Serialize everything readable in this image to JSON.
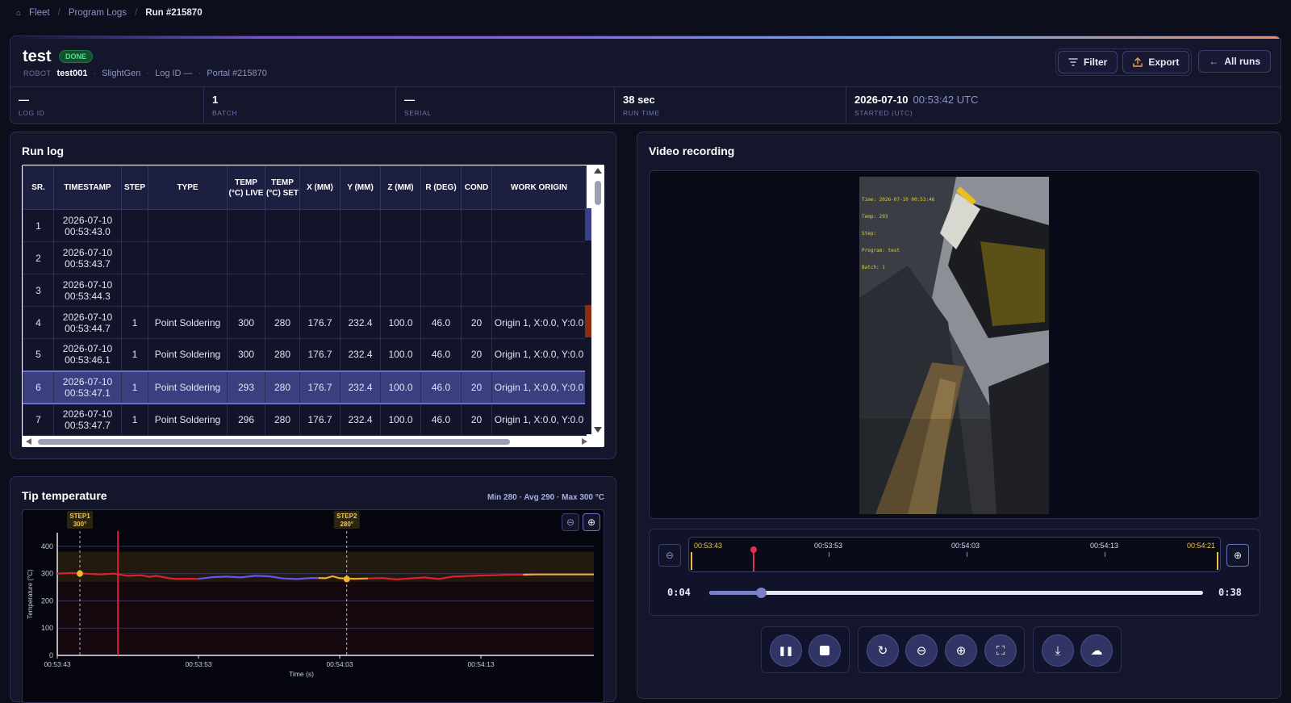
{
  "breadcrumb": {
    "home": "Fleet",
    "mid": "Program Logs",
    "current": "Run #215870"
  },
  "header": {
    "title": "test",
    "status": "DONE",
    "robot_label": "ROBOT",
    "robot": "test001",
    "model": "SlightGen",
    "log_id": "Log ID —",
    "portal": "Portal #215870",
    "buttons": {
      "filter": "Filter",
      "export": "Export",
      "all_runs": "All runs"
    }
  },
  "stats": [
    {
      "value": "—",
      "label": "LOG ID"
    },
    {
      "value": "1",
      "label": "BATCH"
    },
    {
      "value": "—",
      "label": "SERIAL"
    },
    {
      "value": "38 sec",
      "label": "RUN TIME"
    },
    {
      "value": "2026-07-10",
      "sub": "00:53:42 UTC",
      "label": "STARTED (UTC)"
    }
  ],
  "runlog": {
    "title": "Run log",
    "columns": [
      "SR.",
      "TIMESTAMP",
      "STEP",
      "TYPE",
      "TEMP (°C) LIVE",
      "TEMP (°C) SET",
      "X (MM)",
      "Y (MM)",
      "Z (MM)",
      "R (DEG)",
      "COND",
      "WORK ORIGIN"
    ],
    "rows": [
      [
        "1",
        "2026-07-10 00:53:43.0",
        "",
        "",
        "",
        "",
        "",
        "",
        "",
        "",
        "",
        ""
      ],
      [
        "2",
        "2026-07-10 00:53:43.7",
        "",
        "",
        "",
        "",
        "",
        "",
        "",
        "",
        "",
        ""
      ],
      [
        "3",
        "2026-07-10 00:53:44.3",
        "",
        "",
        "",
        "",
        "",
        "",
        "",
        "",
        "",
        ""
      ],
      [
        "4",
        "2026-07-10 00:53:44.7",
        "1",
        "Point Soldering",
        "300",
        "280",
        "176.7",
        "232.4",
        "100.0",
        "46.0",
        "20",
        "Origin 1, X:0.0, Y:0.0"
      ],
      [
        "5",
        "2026-07-10 00:53:46.1",
        "1",
        "Point Soldering",
        "300",
        "280",
        "176.7",
        "232.4",
        "100.0",
        "46.0",
        "20",
        "Origin 1, X:0.0, Y:0.0"
      ],
      [
        "6",
        "2026-07-10 00:53:47.1",
        "1",
        "Point Soldering",
        "293",
        "280",
        "176.7",
        "232.4",
        "100.0",
        "46.0",
        "20",
        "Origin 1, X:0.0, Y:0.0"
      ],
      [
        "7",
        "2026-07-10 00:53:47.7",
        "1",
        "Point Soldering",
        "296",
        "280",
        "176.7",
        "232.4",
        "100.0",
        "46.0",
        "20",
        "Origin 1, X:0.0, Y:0.0"
      ]
    ],
    "selected_row": 6,
    "row_marker_colors": [
      "#3a3f8a",
      "#121429",
      "#121429",
      "#8a2e12",
      "#121429",
      "#121429",
      "#121429"
    ]
  },
  "tiptemp": {
    "title": "Tip temperature",
    "summary": "Min 280 · Avg 290 · Max 300 °C"
  },
  "chart_data": {
    "type": "line",
    "ylabel": "Temperature (°C)",
    "xlabel": "Time (s)",
    "ylim": [
      0,
      450
    ],
    "yticks": [
      0,
      100,
      200,
      300,
      400
    ],
    "xlim": [
      0,
      38
    ],
    "xticks": [
      {
        "t": 0,
        "label": "00:53:43"
      },
      {
        "t": 10,
        "label": "00:53:53"
      },
      {
        "t": 20,
        "label": "00:54:03"
      },
      {
        "t": 30,
        "label": "00:54:13"
      }
    ],
    "setpoint_band": [
      270,
      380
    ],
    "step_markers": [
      {
        "t": 1.6,
        "label": "STEP1",
        "value": "300°",
        "y": 300
      },
      {
        "t": 20.5,
        "label": "STEP2",
        "value": "280°",
        "y": 280
      }
    ],
    "playhead_t": 4.3,
    "series": [
      {
        "color": "#e01f2e",
        "points": [
          [
            0,
            300
          ],
          [
            1,
            302
          ],
          [
            2,
            300
          ],
          [
            3,
            297
          ],
          [
            4,
            300
          ],
          [
            5,
            292
          ],
          [
            6,
            294
          ],
          [
            6.5,
            288
          ],
          [
            7,
            292
          ],
          [
            8,
            282
          ],
          [
            8.5,
            280
          ],
          [
            9,
            281
          ],
          [
            10,
            281
          ]
        ]
      },
      {
        "color": "#6a52f0",
        "points": [
          [
            10,
            281
          ],
          [
            11,
            287
          ],
          [
            12,
            289
          ],
          [
            13,
            286
          ],
          [
            14,
            292
          ],
          [
            15,
            290
          ],
          [
            16,
            282
          ],
          [
            17,
            280
          ],
          [
            18,
            284
          ],
          [
            18.5,
            284
          ]
        ]
      },
      {
        "color": "#f5a531",
        "points": [
          [
            18.5,
            284
          ],
          [
            19,
            283
          ],
          [
            19.5,
            290
          ],
          [
            20,
            283
          ],
          [
            20.5,
            282
          ],
          [
            21,
            281
          ],
          [
            22,
            282
          ]
        ]
      },
      {
        "color": "#e01f2e",
        "points": [
          [
            22,
            282
          ],
          [
            23,
            284
          ],
          [
            24,
            279
          ],
          [
            25,
            282
          ],
          [
            26,
            286
          ],
          [
            27,
            280
          ],
          [
            28,
            289
          ],
          [
            29,
            291
          ],
          [
            30,
            293
          ],
          [
            31,
            294
          ],
          [
            32,
            296
          ],
          [
            33,
            296
          ]
        ]
      },
      {
        "color": "#f5a531",
        "points": [
          [
            33,
            296
          ],
          [
            34,
            297
          ],
          [
            36,
            297
          ],
          [
            38,
            297
          ]
        ]
      }
    ]
  },
  "video": {
    "title": "Video recording",
    "overlay": [
      "Time: 2026-07-10 00:53:46",
      "Temp: 293",
      "Step:",
      "Program: test",
      "Batch: 1"
    ],
    "timeline": {
      "start": "00:53:43",
      "t1": "00:53:53",
      "t2": "00:54:03",
      "t3": "00:54:13",
      "end": "00:54:21"
    },
    "current_time": "0:04",
    "duration": "0:38",
    "progress": 0.105
  }
}
